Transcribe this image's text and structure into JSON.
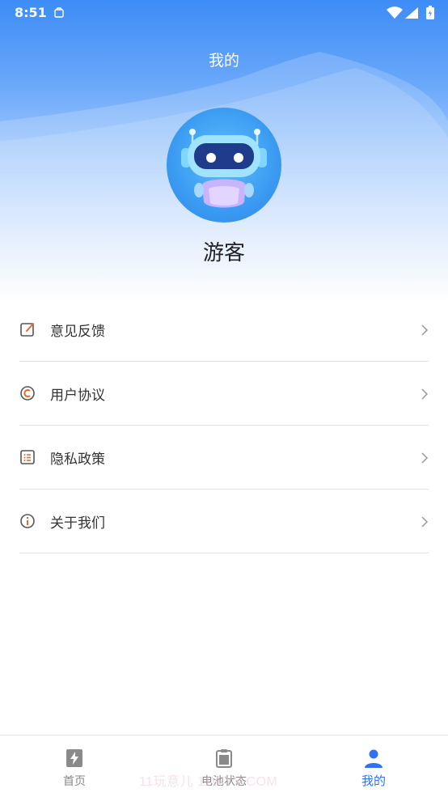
{
  "status_bar": {
    "time": "8:51"
  },
  "header": {
    "title": "我的",
    "username": "游客"
  },
  "menu": {
    "items": [
      {
        "label": "意见反馈",
        "icon": "edit-icon"
      },
      {
        "label": "用户协议",
        "icon": "copyright-icon"
      },
      {
        "label": "隐私政策",
        "icon": "list-icon"
      },
      {
        "label": "关于我们",
        "icon": "info-icon"
      }
    ]
  },
  "tabbar": {
    "tabs": [
      {
        "label": "首页",
        "icon": "lightning-book-icon",
        "active": false
      },
      {
        "label": "电池状态",
        "icon": "clipboard-icon",
        "active": false
      },
      {
        "label": "我的",
        "icon": "person-icon",
        "active": true
      }
    ]
  },
  "watermark": "11玩意儿 11WYX.COM",
  "colors": {
    "accent": "#2f73f0",
    "icon_orange": "#e9672c",
    "header_top": "#3d8cf6"
  }
}
